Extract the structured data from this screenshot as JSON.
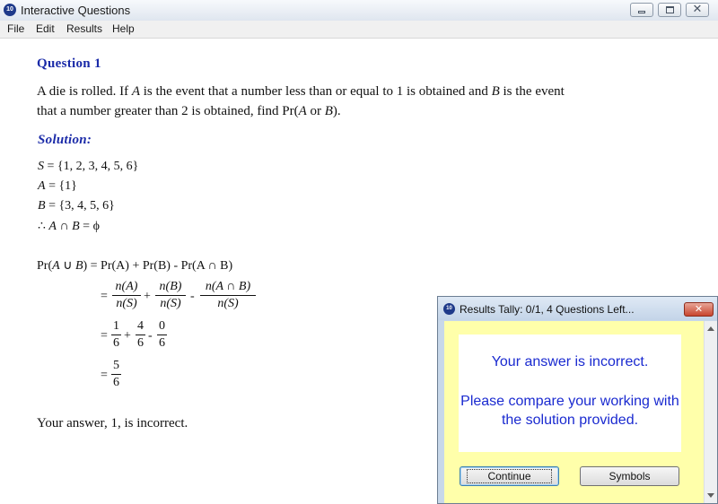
{
  "window": {
    "title": "Interactive Questions",
    "icon_text": "10",
    "buttons": {
      "minimize": "minimize-icon",
      "maximize": "maximize-icon",
      "close": "✕"
    }
  },
  "menu": [
    "File",
    "Edit",
    "Results",
    "Help"
  ],
  "question": {
    "title": "Question 1",
    "line1_a": "A die is rolled.  If ",
    "line1_var_a": "A",
    "line1_b": " is the event that a number less than or equal to 1 is obtained and ",
    "line1_var_b": "B",
    "line1_c": " is the event",
    "line2_a": "that a number greater than 2 is obtained, find Pr(",
    "line2_var_a": "A",
    "line2_b": " or ",
    "line2_var_b": "B",
    "line2_c": ")."
  },
  "solution": {
    "title": "Solution:",
    "sets": [
      {
        "var": "S",
        "value": " = {1, 2, 3, 4, 5, 6}"
      },
      {
        "var": "A",
        "value": " = {1}"
      },
      {
        "var": "B",
        "value": " = {3, 4, 5, 6}"
      }
    ],
    "therefore": {
      "symbol": "∴ ",
      "expr_a": "A",
      "op": " ∩ ",
      "expr_b": "B",
      "rest": " = ϕ"
    },
    "prob_line": {
      "lhs": "Pr(",
      "a": "A",
      "cup": " ∪ ",
      "b": "B",
      "rhs": ") = Pr(A) + Pr(B) - Pr(A ∩ B)"
    },
    "step1": {
      "eq": "=",
      "n1": "n(A)",
      "d1": "n(S)",
      "plus": "+",
      "n2": "n(B)",
      "d2": "n(S)",
      "minus": "-",
      "n3": "n(A ∩ B)",
      "d3": "n(S)"
    },
    "step2": {
      "eq": "=",
      "n1": "1",
      "d1": "6",
      "plus": "+",
      "n2": "4",
      "d2": "6",
      "minus": "-",
      "n3": "0",
      "d3": "6"
    },
    "step3": {
      "eq": "=",
      "n1": "5",
      "d1": "6"
    }
  },
  "answer_text": "Your answer, 1, is incorrect.",
  "dialog": {
    "title": "Results Tally: 0/1, 4 Questions Left...",
    "icon_text": "10",
    "close": "✕",
    "message1": "Your answer is incorrect.",
    "message2": "Please compare your working with the solution provided.",
    "continue_label": "Continue",
    "symbols_label": "Symbols"
  },
  "colors": {
    "heading": "#1a2aa8",
    "dialog_text": "#1a2ad0",
    "dialog_bg": "#ffffaa"
  }
}
